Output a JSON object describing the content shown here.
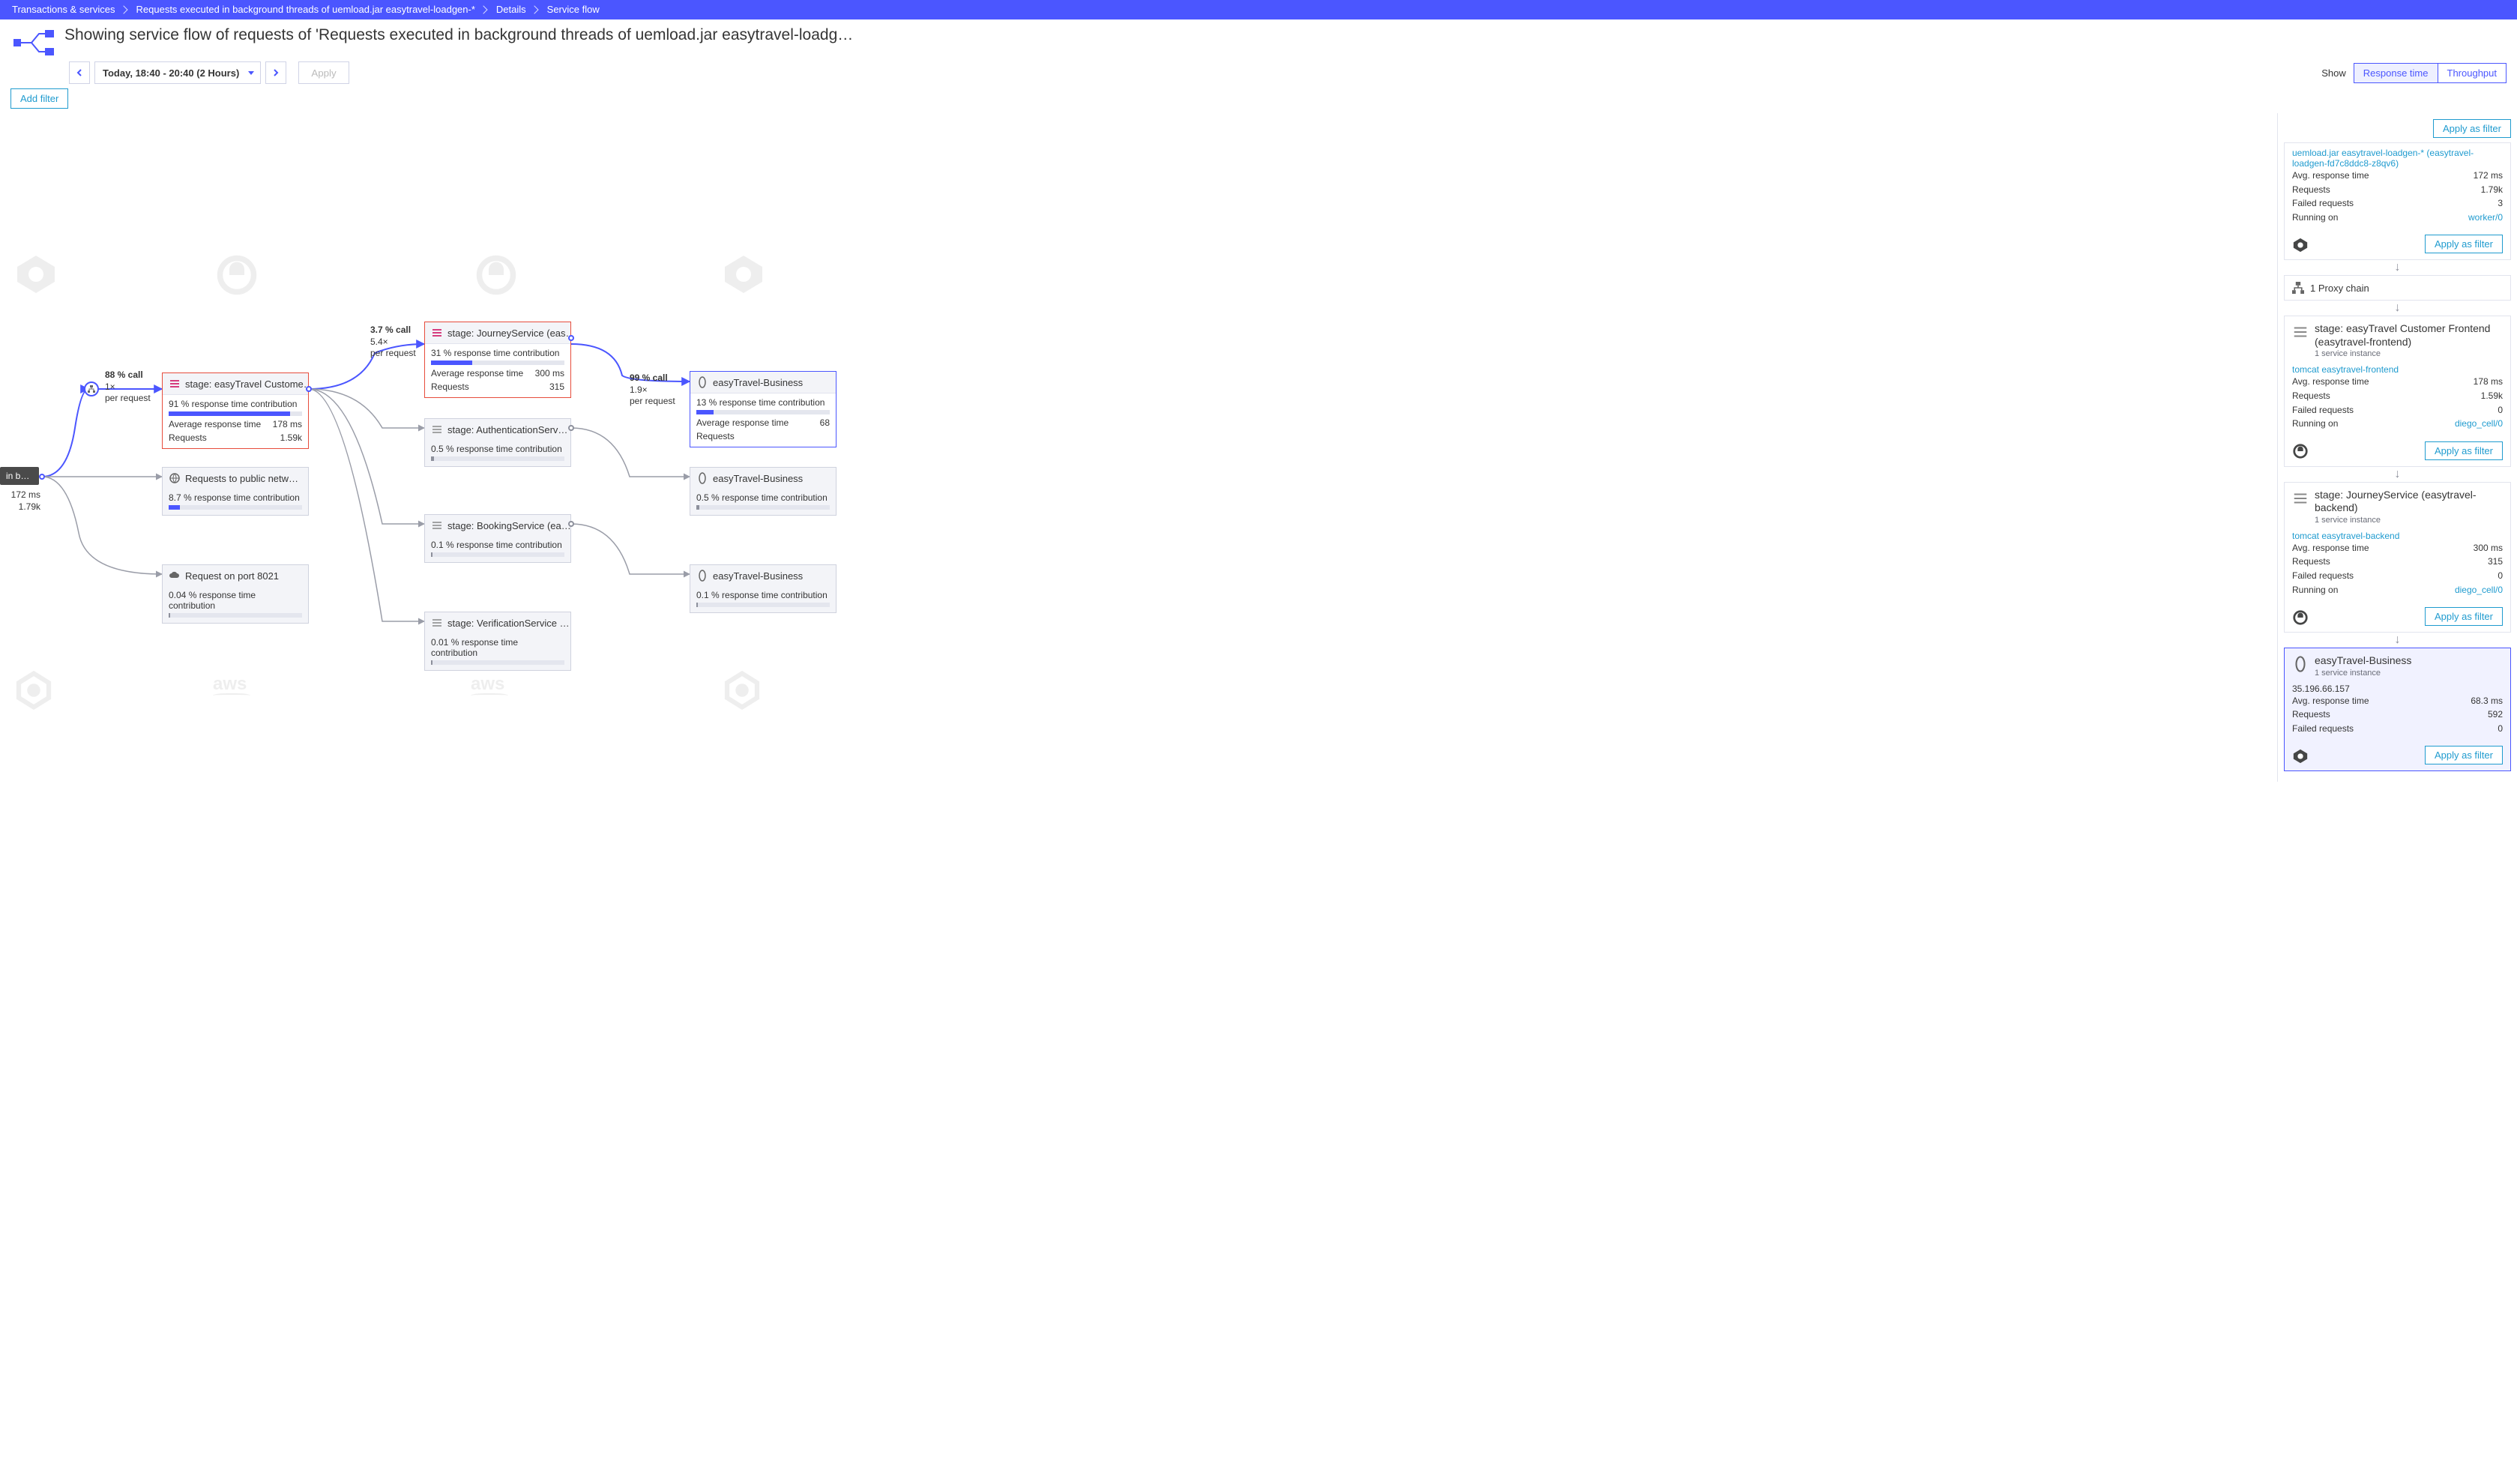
{
  "breadcrumbs": [
    "Transactions & services",
    "Requests executed in background threads of uemload.jar easytravel-loadgen-*",
    "Details",
    "Service flow"
  ],
  "page_title": "Showing service flow of requests of 'Requests executed in background threads of uemload.jar easytravel-loadg…",
  "toolbar": {
    "time_label": "Today, 18:40 - 20:40 (2 Hours)",
    "apply": "Apply",
    "show_label": "Show"
  },
  "segments": {
    "resp": "Response time",
    "thr": "Throughput"
  },
  "add_filter": "Add filter",
  "source": {
    "chip": "in bac…",
    "stat1": "172 ms",
    "stat2": "1.79k"
  },
  "edges": {
    "e1": {
      "l1": "88 % call",
      "l2": "1×",
      "l3": "per request"
    },
    "e2": {
      "l1": "3.7 % call",
      "l2": "5.4×",
      "l3": "per request"
    },
    "e3": {
      "l1": "99 % call",
      "l2": "1.9×",
      "l3": "per request"
    }
  },
  "nodes": {
    "n1": {
      "title": "stage: easyTravel Custome…",
      "rtc": "91 % response time contribution",
      "pct": 91,
      "art_l": "Average response time",
      "art_v": "178 ms",
      "req_l": "Requests",
      "req_v": "1.59k"
    },
    "n2": {
      "title": "Requests to public netw…",
      "rtc": "8.7 % response time contribution",
      "pct": 8.7
    },
    "n3": {
      "title": "Request on port 8021",
      "rtc": "0.04 % response time contribution",
      "pct": 0.4
    },
    "n4": {
      "title": "stage: JourneyService (eas…",
      "rtc": "31 % response time contribution",
      "pct": 31,
      "art_l": "Average response time",
      "art_v": "300 ms",
      "req_l": "Requests",
      "req_v": "315"
    },
    "n5": {
      "title": "stage: AuthenticationServ…",
      "rtc": "0.5 % response time contribution",
      "pct": 1
    },
    "n6": {
      "title": "stage: BookingService (ea…",
      "rtc": "0.1 % response time contribution",
      "pct": 0.5
    },
    "n7": {
      "title": "stage: VerificationService …",
      "rtc": "0.01 % response time contribution",
      "pct": 0.3
    },
    "n8": {
      "title": "easyTravel-Business",
      "rtc": "13 % response time contribution",
      "pct": 13,
      "art_l": "Average response time",
      "art_v": "68",
      "req_l": "Requests",
      "req_v": ""
    },
    "n9": {
      "title": "easyTravel-Business",
      "rtc": "0.5 % response time contribution",
      "pct": 1
    },
    "n10": {
      "title": "easyTravel-Business",
      "rtc": "0.1 % response time contribution",
      "pct": 0.5
    }
  },
  "sidepanel": {
    "apply": "Apply as filter",
    "proxy": "1 Proxy chain",
    "b1": {
      "head": "uemload.jar easytravel-loadgen-* (easytravel-loadgen-fd7c8ddc8-z8qv6)",
      "r1l": "Avg. response time",
      "r1v": "172 ms",
      "r2l": "Requests",
      "r2v": "1.79k",
      "r3l": "Failed requests",
      "r3v": "3",
      "r4l": "Running on",
      "r4v": "worker/0"
    },
    "b2": {
      "head": "stage: easyTravel Customer Frontend (easytravel-frontend)",
      "sub": "1 service instance",
      "link": "tomcat easytravel-frontend",
      "r1l": "Avg. response time",
      "r1v": "178 ms",
      "r2l": "Requests",
      "r2v": "1.59k",
      "r3l": "Failed requests",
      "r3v": "0",
      "r4l": "Running on",
      "r4v": "diego_cell/0"
    },
    "b3": {
      "head": "stage: JourneyService (easytravel-backend)",
      "sub": "1 service instance",
      "link": "tomcat easytravel-backend",
      "r1l": "Avg. response time",
      "r1v": "300 ms",
      "r2l": "Requests",
      "r2v": "315",
      "r3l": "Failed requests",
      "r3v": "0",
      "r4l": "Running on",
      "r4v": "diego_cell/0"
    },
    "b4": {
      "head": "easyTravel-Business",
      "sub": "1 service instance",
      "link": "35.196.66.157",
      "r1l": "Avg. response time",
      "r1v": "68.3 ms",
      "r2l": "Requests",
      "r2v": "592",
      "r3l": "Failed requests",
      "r3v": "0"
    }
  }
}
